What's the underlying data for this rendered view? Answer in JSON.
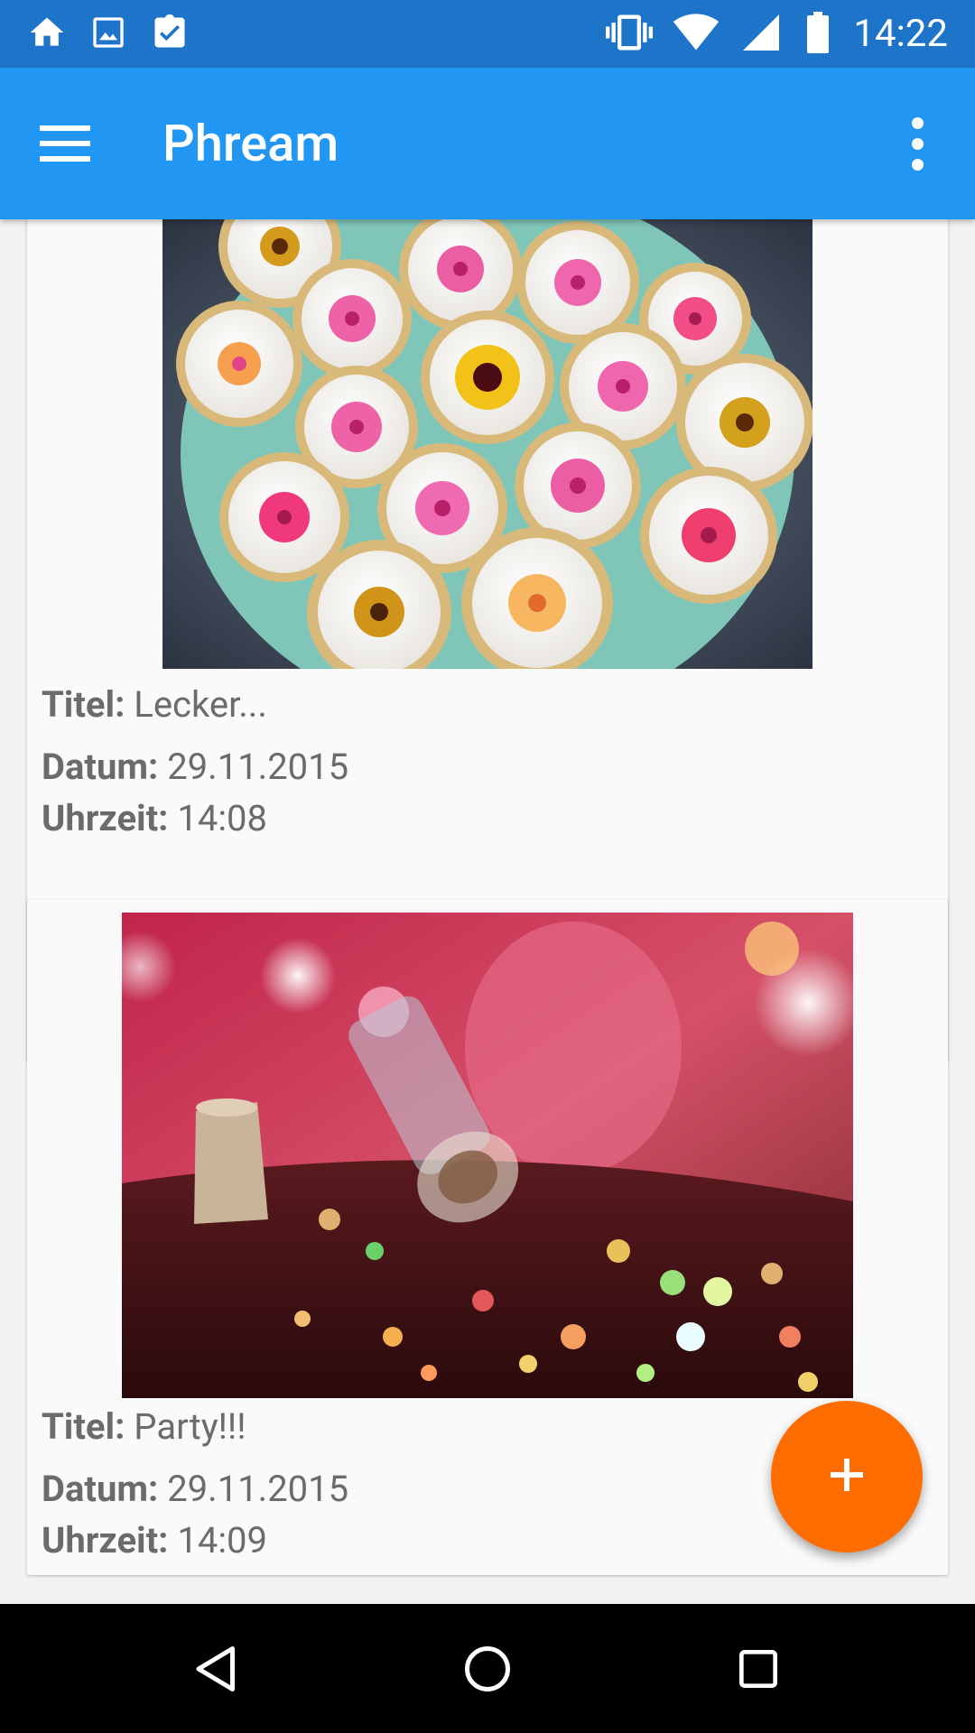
{
  "status_bar": {
    "time": "14:22",
    "left_icons": [
      "home-icon",
      "image-icon",
      "clipboard-check-icon"
    ],
    "right_icons": [
      "vibrate-icon",
      "wifi-icon",
      "cell-signal-icon",
      "battery-icon"
    ]
  },
  "app_bar": {
    "title": "Phream",
    "menu_icon": "hamburger-menu-icon",
    "overflow_icon": "more-vert-icon"
  },
  "entries": [
    {
      "image": "cupcakes-photo",
      "title_label": "Titel:",
      "title": "Lecker...",
      "date_label": "Datum:",
      "date": "29.11.2015",
      "time_label": "Uhrzeit:",
      "time": "14:08"
    },
    {
      "image": "party-bottle-photo",
      "title_label": "Titel:",
      "title": "Party!!!",
      "date_label": "Datum:",
      "date": "29.11.2015",
      "time_label": "Uhrzeit:",
      "time": "14:09"
    }
  ],
  "fab": {
    "icon": "plus-icon",
    "color": "#ff6d00"
  },
  "nav_bar": {
    "icons": [
      "back-icon",
      "home-circle-icon",
      "recents-icon"
    ]
  },
  "colors": {
    "status_bar": "#1e74c8",
    "app_bar": "#2196f3",
    "accent": "#ff6d00",
    "card": "#fafafa",
    "text": "#6b6b6b"
  }
}
